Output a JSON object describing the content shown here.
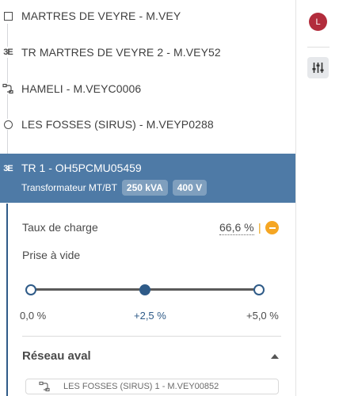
{
  "tree": {
    "nodes": [
      {
        "icon": "square-node-icon",
        "label": "MARTRES DE VEYRE - M.VEY"
      },
      {
        "icon": "transformer-icon",
        "label": "TR MARTRES DE VEYRE 2 - M.VEY52"
      },
      {
        "icon": "branch-connector-icon",
        "label": "HAMELI - M.VEYC0006"
      },
      {
        "icon": "circle-node-icon",
        "label": "LES FOSSES (SIRUS) - M.VEYP0288"
      }
    ],
    "selected": {
      "icon": "transformer-icon",
      "title": "TR 1 - OH5PCMU05459",
      "type": "Transformateur MT/BT",
      "badges": [
        "250 kVA",
        "400 V"
      ]
    }
  },
  "detail": {
    "load_label": "Taux de charge",
    "load_value": "66,6 %",
    "load_percent": 66.6,
    "load_separator": "|",
    "status_color": "#f5a623",
    "no_load_label": "Prise à vide",
    "slider": {
      "ticks": [
        "0,0 %",
        "+2,5 %",
        "+5,0 %"
      ],
      "selected_index": 1
    },
    "downstream_title": "Réseau aval",
    "downstream_items": [
      {
        "icon": "branch-connector-icon",
        "label": "LES FOSSES (SIRUS) 1 - M.VEY00852"
      }
    ]
  },
  "sidebar_right": {
    "avatar_initial": "L",
    "avatar_color": "#b22c3c",
    "settings_icon": "sliders-icon"
  },
  "colors": {
    "selection": "#4e7aa6",
    "accent": "#2f5b88"
  }
}
